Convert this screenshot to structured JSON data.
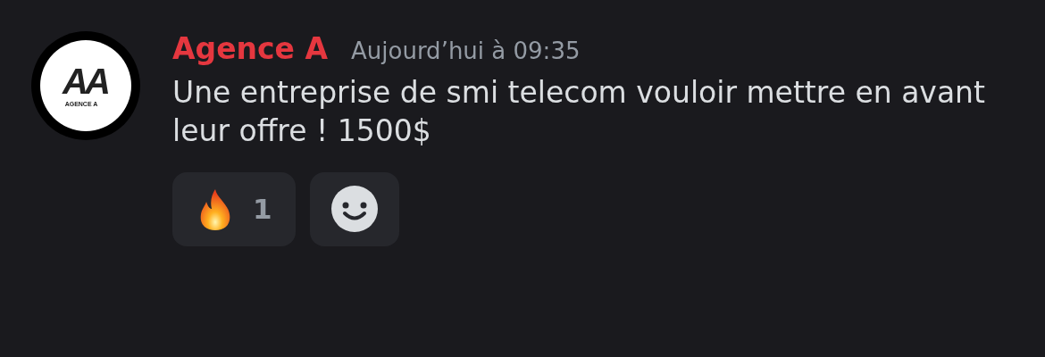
{
  "avatar": {
    "logo_mark": "AA",
    "logo_text": "AGENCE A"
  },
  "author": {
    "name": "Agence A",
    "color": "#e5373f"
  },
  "timestamp": "Aujourd’hui à 09:35",
  "message": "Une entreprise de smi telecom vouloir mettre en avant leur offre ! 1500$",
  "reactions": [
    {
      "kind": "fire",
      "count": "1",
      "selected": false
    }
  ]
}
